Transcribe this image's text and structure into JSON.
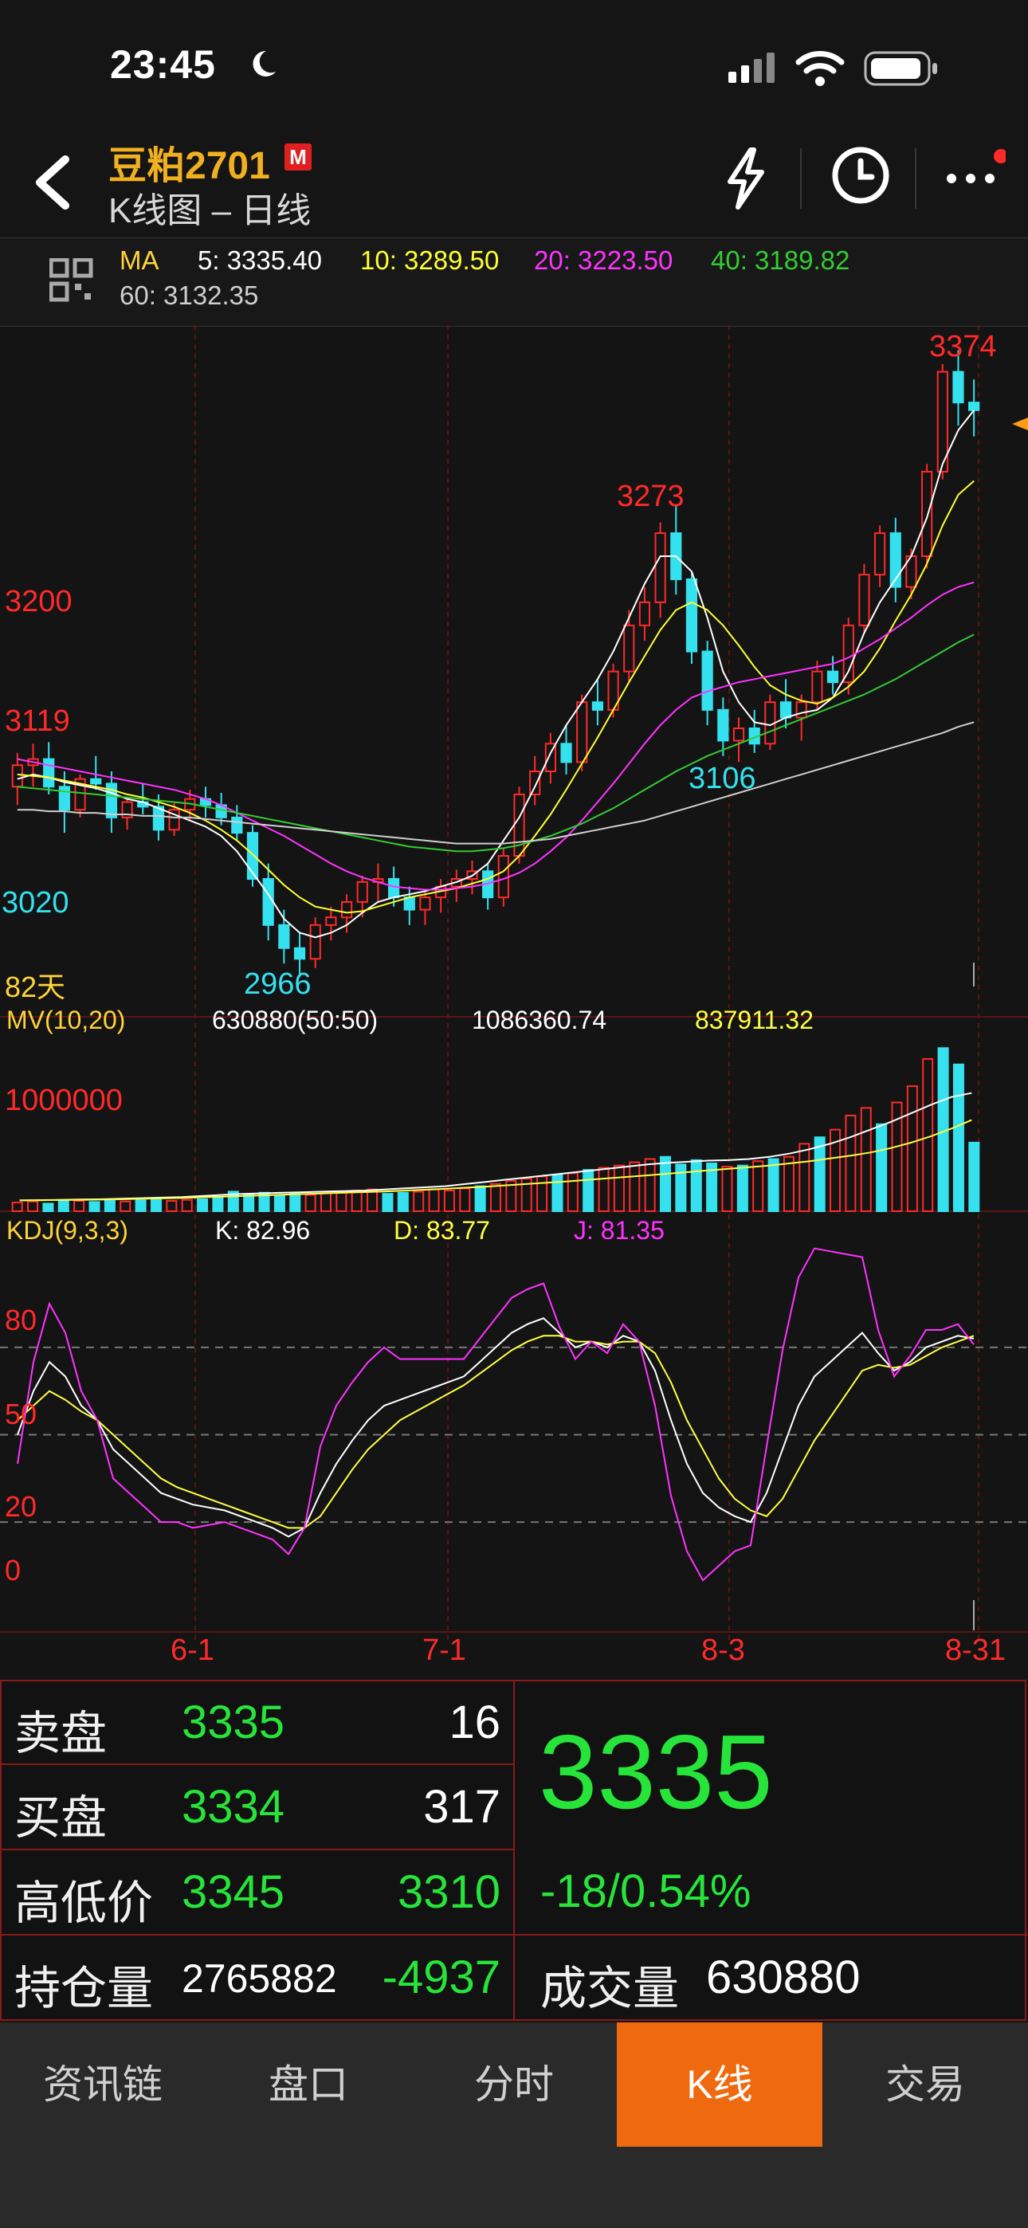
{
  "status": {
    "time": "23:45"
  },
  "header": {
    "symbol": "豆粕2701",
    "badge": "M",
    "subtitle": "K线图 – 日线"
  },
  "ma_bar": {
    "label": "MA",
    "ma5": "5: 3335.40",
    "ma10": "10: 3289.50",
    "ma20": "20: 3223.50",
    "ma40": "40: 3189.82",
    "ma60": "60: 3132.35",
    "colors": {
      "ma5": "#ffffff",
      "ma10": "#ffff33",
      "ma20": "#ff33ff",
      "ma40": "#33cc33",
      "ma60": "#cfcfcf"
    }
  },
  "chart_data": [
    {
      "type": "candlestick",
      "title": "",
      "price_labels": [
        "3200",
        "3119",
        "3020"
      ],
      "annotations": [
        "3374",
        "3273",
        "3106",
        "2966"
      ],
      "days_label": "82天",
      "x_ticks": [
        "6-1",
        "7-1",
        "8-3",
        "8-31"
      ],
      "ylim": [
        2960,
        3380
      ],
      "ohlc": [
        [
          3090,
          3112,
          3078,
          3104
        ],
        [
          3104,
          3118,
          3090,
          3108
        ],
        [
          3108,
          3119,
          3085,
          3090
        ],
        [
          3090,
          3100,
          3060,
          3075
        ],
        [
          3075,
          3098,
          3070,
          3095
        ],
        [
          3095,
          3110,
          3088,
          3092
        ],
        [
          3092,
          3100,
          3060,
          3070
        ],
        [
          3070,
          3082,
          3062,
          3080
        ],
        [
          3080,
          3092,
          3072,
          3077
        ],
        [
          3077,
          3085,
          3055,
          3062
        ],
        [
          3062,
          3080,
          3058,
          3075
        ],
        [
          3075,
          3088,
          3068,
          3082
        ],
        [
          3082,
          3090,
          3070,
          3078
        ],
        [
          3078,
          3086,
          3065,
          3070
        ],
        [
          3070,
          3078,
          3055,
          3060
        ],
        [
          3060,
          3065,
          3025,
          3030
        ],
        [
          3030,
          3040,
          2990,
          3000
        ],
        [
          3000,
          3010,
          2975,
          2985
        ],
        [
          2985,
          2995,
          2966,
          2978
        ],
        [
          2978,
          3005,
          2972,
          3000
        ],
        [
          3000,
          3012,
          2990,
          3005
        ],
        [
          3005,
          3020,
          2995,
          3015
        ],
        [
          3015,
          3032,
          3005,
          3028
        ],
        [
          3028,
          3040,
          3015,
          3030
        ],
        [
          3030,
          3038,
          3012,
          3018
        ],
        [
          3018,
          3025,
          3000,
          3010
        ],
        [
          3010,
          3022,
          3000,
          3018
        ],
        [
          3018,
          3030,
          3008,
          3025
        ],
        [
          3025,
          3036,
          3015,
          3030
        ],
        [
          3030,
          3042,
          3020,
          3035
        ],
        [
          3035,
          3040,
          3010,
          3018
        ],
        [
          3018,
          3050,
          3012,
          3045
        ],
        [
          3045,
          3090,
          3040,
          3085
        ],
        [
          3085,
          3110,
          3078,
          3100
        ],
        [
          3100,
          3125,
          3092,
          3118
        ],
        [
          3118,
          3130,
          3098,
          3106
        ],
        [
          3106,
          3150,
          3100,
          3145
        ],
        [
          3145,
          3160,
          3130,
          3140
        ],
        [
          3140,
          3170,
          3135,
          3165
        ],
        [
          3165,
          3205,
          3158,
          3195
        ],
        [
          3195,
          3220,
          3185,
          3210
        ],
        [
          3210,
          3262,
          3200,
          3255
        ],
        [
          3255,
          3273,
          3215,
          3225
        ],
        [
          3225,
          3230,
          3170,
          3178
        ],
        [
          3178,
          3185,
          3130,
          3140
        ],
        [
          3140,
          3148,
          3110,
          3120
        ],
        [
          3120,
          3135,
          3106,
          3128
        ],
        [
          3128,
          3140,
          3112,
          3118
        ],
        [
          3118,
          3150,
          3114,
          3145
        ],
        [
          3145,
          3160,
          3128,
          3135
        ],
        [
          3135,
          3150,
          3120,
          3145
        ],
        [
          3145,
          3172,
          3140,
          3165
        ],
        [
          3165,
          3175,
          3150,
          3158
        ],
        [
          3158,
          3200,
          3150,
          3195
        ],
        [
          3195,
          3235,
          3190,
          3228
        ],
        [
          3228,
          3260,
          3220,
          3255
        ],
        [
          3255,
          3265,
          3210,
          3220
        ],
        [
          3220,
          3245,
          3212,
          3240
        ],
        [
          3240,
          3300,
          3232,
          3295
        ],
        [
          3295,
          3365,
          3290,
          3360
        ],
        [
          3360,
          3374,
          3325,
          3340
        ],
        [
          3340,
          3355,
          3318,
          3335
        ]
      ],
      "ma_series": [
        {
          "name": "MA5",
          "color": "#ffffff",
          "values": [
            3095,
            3098,
            3096,
            3093,
            3091,
            3089,
            3086,
            3082,
            3080,
            3076,
            3072,
            3068,
            3064,
            3058,
            3048,
            3034,
            3020,
            3004,
            2995,
            2992,
            2995,
            3000,
            3008,
            3015,
            3018,
            3020,
            3022,
            3025,
            3028,
            3032,
            3040,
            3055,
            3070,
            3090,
            3112,
            3130,
            3145,
            3160,
            3178,
            3200,
            3222,
            3240,
            3240,
            3230,
            3200,
            3165,
            3145,
            3132,
            3130,
            3135,
            3138,
            3140,
            3148,
            3165,
            3190,
            3210,
            3225,
            3240,
            3265,
            3300,
            3322,
            3335
          ]
        },
        {
          "name": "MA10",
          "color": "#ffff33",
          "values": [
            3098,
            3097,
            3096,
            3094,
            3092,
            3090,
            3088,
            3085,
            3083,
            3080,
            3077,
            3073,
            3068,
            3062,
            3055,
            3046,
            3036,
            3026,
            3018,
            3012,
            3010,
            3008,
            3009,
            3012,
            3015,
            3018,
            3020,
            3022,
            3024,
            3027,
            3030,
            3035,
            3045,
            3058,
            3072,
            3088,
            3105,
            3122,
            3140,
            3158,
            3175,
            3192,
            3205,
            3210,
            3205,
            3195,
            3182,
            3168,
            3156,
            3150,
            3146,
            3144,
            3148,
            3155,
            3165,
            3180,
            3198,
            3215,
            3235,
            3260,
            3280,
            3289
          ]
        },
        {
          "name": "MA20",
          "color": "#ff33ff",
          "values": [
            3108,
            3106,
            3104,
            3102,
            3100,
            3098,
            3096,
            3094,
            3092,
            3090,
            3088,
            3085,
            3082,
            3078,
            3073,
            3068,
            3063,
            3058,
            3052,
            3046,
            3040,
            3035,
            3031,
            3028,
            3025,
            3024,
            3023,
            3023,
            3024,
            3025,
            3027,
            3030,
            3034,
            3040,
            3048,
            3057,
            3068,
            3080,
            3092,
            3105,
            3118,
            3130,
            3140,
            3148,
            3152,
            3155,
            3158,
            3160,
            3162,
            3164,
            3166,
            3168,
            3170,
            3174,
            3180,
            3186,
            3193,
            3200,
            3208,
            3215,
            3220,
            3223
          ]
        },
        {
          "name": "MA40",
          "color": "#33cc33",
          "values": [
            3090,
            3089,
            3088,
            3087,
            3086,
            3085,
            3084,
            3083,
            3082,
            3081,
            3080,
            3079,
            3077,
            3075,
            3073,
            3071,
            3069,
            3067,
            3065,
            3063,
            3061,
            3059,
            3057,
            3055,
            3053,
            3051,
            3050,
            3049,
            3048,
            3048,
            3049,
            3050,
            3052,
            3055,
            3058,
            3062,
            3066,
            3071,
            3076,
            3082,
            3088,
            3094,
            3100,
            3105,
            3110,
            3114,
            3118,
            3122,
            3126,
            3130,
            3134,
            3138,
            3142,
            3146,
            3150,
            3155,
            3160,
            3166,
            3172,
            3178,
            3184,
            3189
          ]
        },
        {
          "name": "MA60",
          "color": "#cfcfcf",
          "values": [
            3075,
            3075,
            3074,
            3074,
            3073,
            3073,
            3072,
            3072,
            3071,
            3071,
            3070,
            3070,
            3069,
            3068,
            3067,
            3066,
            3065,
            3064,
            3063,
            3062,
            3061,
            3060,
            3059,
            3058,
            3057,
            3056,
            3055,
            3054,
            3053,
            3053,
            3053,
            3053,
            3054,
            3055,
            3056,
            3058,
            3060,
            3062,
            3064,
            3066,
            3068,
            3071,
            3074,
            3077,
            3080,
            3083,
            3086,
            3089,
            3092,
            3095,
            3098,
            3101,
            3104,
            3107,
            3110,
            3113,
            3116,
            3119,
            3122,
            3125,
            3129,
            3132
          ]
        }
      ]
    },
    {
      "type": "bar",
      "title": "MV(10,20)",
      "label_1": "630880(50:50)",
      "label_2": "1086360.74",
      "label_3": "837911.32",
      "y_label": "1000000",
      "ylim": [
        0,
        1700000
      ],
      "values": [
        80000,
        90000,
        70000,
        100000,
        95000,
        85000,
        110000,
        90000,
        100000,
        120000,
        95000,
        105000,
        110000,
        130000,
        180000,
        150000,
        170000,
        140000,
        160000,
        150000,
        180000,
        170000,
        190000,
        200000,
        160000,
        170000,
        180000,
        200000,
        190000,
        210000,
        230000,
        250000,
        280000,
        300000,
        320000,
        330000,
        350000,
        380000,
        400000,
        420000,
        450000,
        480000,
        500000,
        430000,
        470000,
        440000,
        410000,
        420000,
        460000,
        480000,
        500000,
        620000,
        680000,
        750000,
        880000,
        950000,
        800000,
        1000000,
        1150000,
        1400000,
        1500000,
        1350000,
        630880
      ],
      "ma10": [
        100000,
        102000,
        105000,
        108000,
        110000,
        115000,
        120000,
        125000,
        130000,
        140000,
        150000,
        160000,
        165000,
        170000,
        175000,
        180000,
        185000,
        190000,
        200000,
        210000,
        220000,
        230000,
        250000,
        270000,
        290000,
        310000,
        330000,
        350000,
        370000,
        390000,
        410000,
        430000,
        445000,
        455000,
        465000,
        470000,
        480000,
        500000,
        530000,
        570000,
        620000,
        680000,
        750000,
        820000,
        900000,
        980000,
        1050000,
        1086360
      ],
      "ma20": [
        100000,
        101000,
        103000,
        105000,
        107000,
        110000,
        114000,
        118000,
        122000,
        128000,
        134000,
        140000,
        146000,
        152000,
        158000,
        164000,
        170000,
        176000,
        182000,
        190000,
        198000,
        206000,
        216000,
        226000,
        238000,
        250000,
        262000,
        274000,
        288000,
        302000,
        316000,
        330000,
        345000,
        360000,
        375000,
        390000,
        405000,
        420000,
        440000,
        460000,
        485000,
        510000,
        540000,
        580000,
        630000,
        690000,
        760000,
        837911
      ]
    },
    {
      "type": "line",
      "title": "KDJ(9,3,3)",
      "k_label": "K: 82.96",
      "d_label": "D: 83.77",
      "j_label": "J: 81.35",
      "y_ticks": [
        "80",
        "50",
        "20",
        "0"
      ],
      "ylim": [
        -15,
        115
      ],
      "series": [
        {
          "name": "K",
          "color": "#ffffff",
          "values": [
            50,
            65,
            75,
            70,
            60,
            55,
            45,
            40,
            35,
            30,
            28,
            26,
            25,
            24,
            22,
            20,
            18,
            15,
            18,
            30,
            40,
            48,
            55,
            60,
            62,
            64,
            66,
            68,
            70,
            75,
            80,
            85,
            88,
            90,
            85,
            80,
            82,
            80,
            84,
            82,
            72,
            55,
            40,
            30,
            25,
            22,
            20,
            30,
            45,
            60,
            70,
            75,
            80,
            85,
            78,
            72,
            75,
            80,
            82,
            84,
            83
          ]
        },
        {
          "name": "D",
          "color": "#ffff44",
          "values": [
            55,
            60,
            65,
            62,
            58,
            55,
            50,
            45,
            40,
            35,
            32,
            30,
            28,
            26,
            24,
            22,
            20,
            18,
            18,
            22,
            30,
            38,
            45,
            50,
            55,
            58,
            61,
            64,
            67,
            71,
            75,
            79,
            82,
            84,
            84,
            82,
            82,
            81,
            82,
            82,
            78,
            68,
            55,
            45,
            35,
            28,
            24,
            22,
            28,
            38,
            48,
            56,
            64,
            72,
            74,
            73,
            74,
            77,
            80,
            82,
            84
          ]
        },
        {
          "name": "J",
          "color": "#ff33ff",
          "values": [
            40,
            75,
            95,
            85,
            65,
            55,
            35,
            30,
            25,
            20,
            20,
            18,
            19,
            20,
            18,
            16,
            14,
            9,
            18,
            46,
            60,
            68,
            75,
            80,
            76,
            76,
            76,
            76,
            76,
            83,
            90,
            97,
            100,
            102,
            87,
            76,
            82,
            78,
            88,
            82,
            60,
            29,
            10,
            0,
            5,
            10,
            12,
            46,
            79,
            104,
            114,
            113,
            112,
            111,
            86,
            70,
            77,
            86,
            86,
            88,
            81
          ]
        }
      ]
    }
  ],
  "quote": {
    "rows": [
      {
        "label": "卖盘",
        "v1": "3335",
        "v2": "16"
      },
      {
        "label": "买盘",
        "v1": "3334",
        "v2": "317"
      },
      {
        "label": "高低价",
        "v1": "3345",
        "v2": "3310"
      },
      {
        "label": "持仓量",
        "v1": "2765882",
        "v2": "-4937"
      }
    ],
    "last_price": "3335",
    "change": "-18/0.54%",
    "volume_label": "成交量",
    "volume": "630880"
  },
  "tabs": [
    "资讯链",
    "盘口",
    "分时",
    "K线",
    "交易"
  ],
  "active_tab": "K线"
}
